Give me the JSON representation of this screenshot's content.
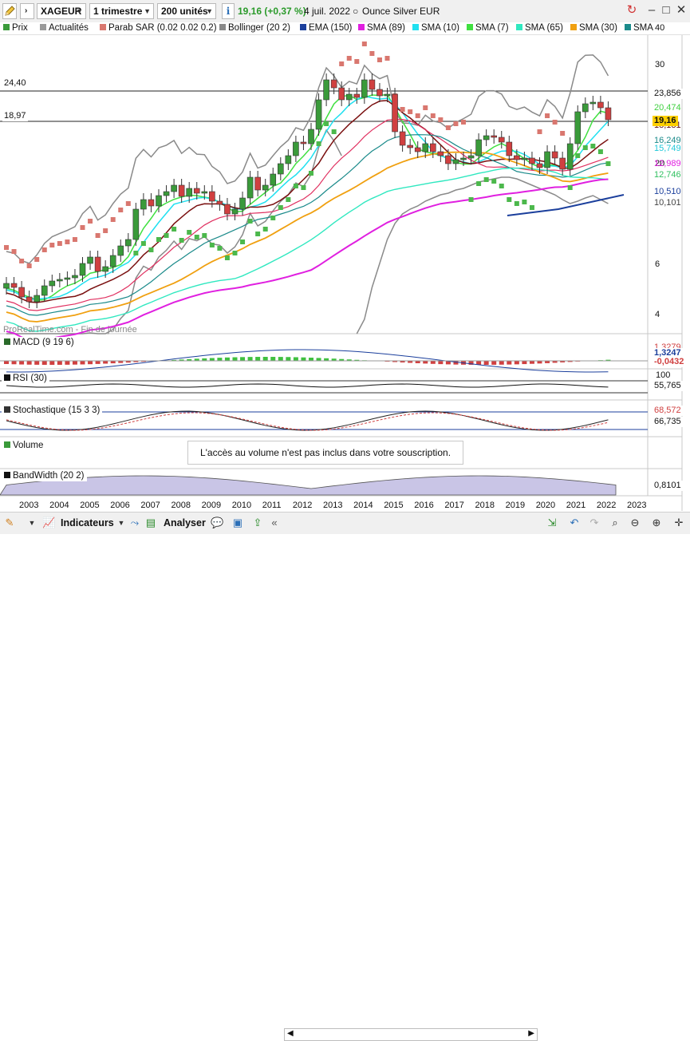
{
  "toolbar": {
    "symbol": "XAGEUR",
    "period": "1 trimestre",
    "units": "200 unités",
    "info_icon": "i",
    "change": "19,16 (+0,37 %)",
    "date": "4 juil. 2022",
    "instrument": "Ounce Silver EUR"
  },
  "legend": [
    {
      "label": "Prix",
      "color": "#3a9a3a"
    },
    {
      "label": "Actualités",
      "color": "#999999"
    },
    {
      "label": "Parab SAR (0.02 0.02 0.2)",
      "color": "#d9776f"
    },
    {
      "label": "Bollinger (20 2)",
      "color": "#888888"
    },
    {
      "label": "EMA (150)",
      "color": "#1b3f9c"
    },
    {
      "label": "SMA (89)",
      "color": "#e020e0"
    },
    {
      "label": "SMA (10)",
      "color": "#20e0f0"
    },
    {
      "label": "SMA (7)",
      "color": "#40e040"
    },
    {
      "label": "SMA (65)",
      "color": "#30e8c0"
    },
    {
      "label": "SMA (30)",
      "color": "#f0a010"
    },
    {
      "label": "SMA",
      "color": "#1a8a8a"
    }
  ],
  "price_axis": {
    "ticks": [
      "40",
      "30",
      "20",
      "6",
      "4"
    ],
    "h_lines": [
      "24,40",
      "18,97"
    ],
    "right_values": [
      {
        "text": "23,856",
        "color": "#111111",
        "bg": "#ffffff"
      },
      {
        "text": "20,474",
        "color": "#40d040",
        "bg": "#ffffff"
      },
      {
        "text": "19,16",
        "color": "#111111",
        "bg": "#ffd000"
      },
      {
        "text": "18,181",
        "color": "#5a1010",
        "bg": "#ffffff"
      },
      {
        "text": "16,249",
        "color": "#1a8a8a",
        "bg": "#ffffff"
      },
      {
        "text": "15,749",
        "color": "#20d0e0",
        "bg": "#ffffff"
      },
      {
        "text": "12,989",
        "color": "#e020e0",
        "bg": "#ffffff"
      },
      {
        "text": "12,746",
        "color": "#30c060",
        "bg": "#ffffff"
      },
      {
        "text": "10,510",
        "color": "#1b3f9c",
        "bg": "#ffffff"
      },
      {
        "text": "10,101",
        "color": "#444444",
        "bg": "#ffffff"
      }
    ],
    "watermark": "ProRealTime.com - Fin de journée"
  },
  "macd": {
    "label": "MACD (9 19 6)",
    "values": [
      "1,3279",
      "1,3247",
      "-0,0432"
    ]
  },
  "rsi": {
    "label": "RSI (30)",
    "values": [
      "100",
      "55,765"
    ]
  },
  "stoch": {
    "label": "Stochastique (15 3 3)",
    "values": [
      "68,572",
      "66,735"
    ]
  },
  "volume": {
    "label": "Volume",
    "notice": "L'accès au volume n'est pas inclus dans votre souscription."
  },
  "bandwidth": {
    "label": "BandWidth (20 2)",
    "value": "0,8101"
  },
  "x_axis": [
    "2003",
    "2004",
    "2005",
    "2006",
    "2007",
    "2008",
    "2009",
    "2010",
    "2011",
    "2012",
    "2013",
    "2014",
    "2015",
    "2016",
    "2017",
    "2018",
    "2019",
    "2020",
    "2021",
    "2022",
    "2023"
  ],
  "bottombar": {
    "indicators": "Indicateurs",
    "analyze": "Analyser"
  },
  "colors": {
    "up": "#3a9a3a",
    "down": "#d04040",
    "sar_up": "#4cb84c",
    "sar_down": "#d9776f"
  }
}
